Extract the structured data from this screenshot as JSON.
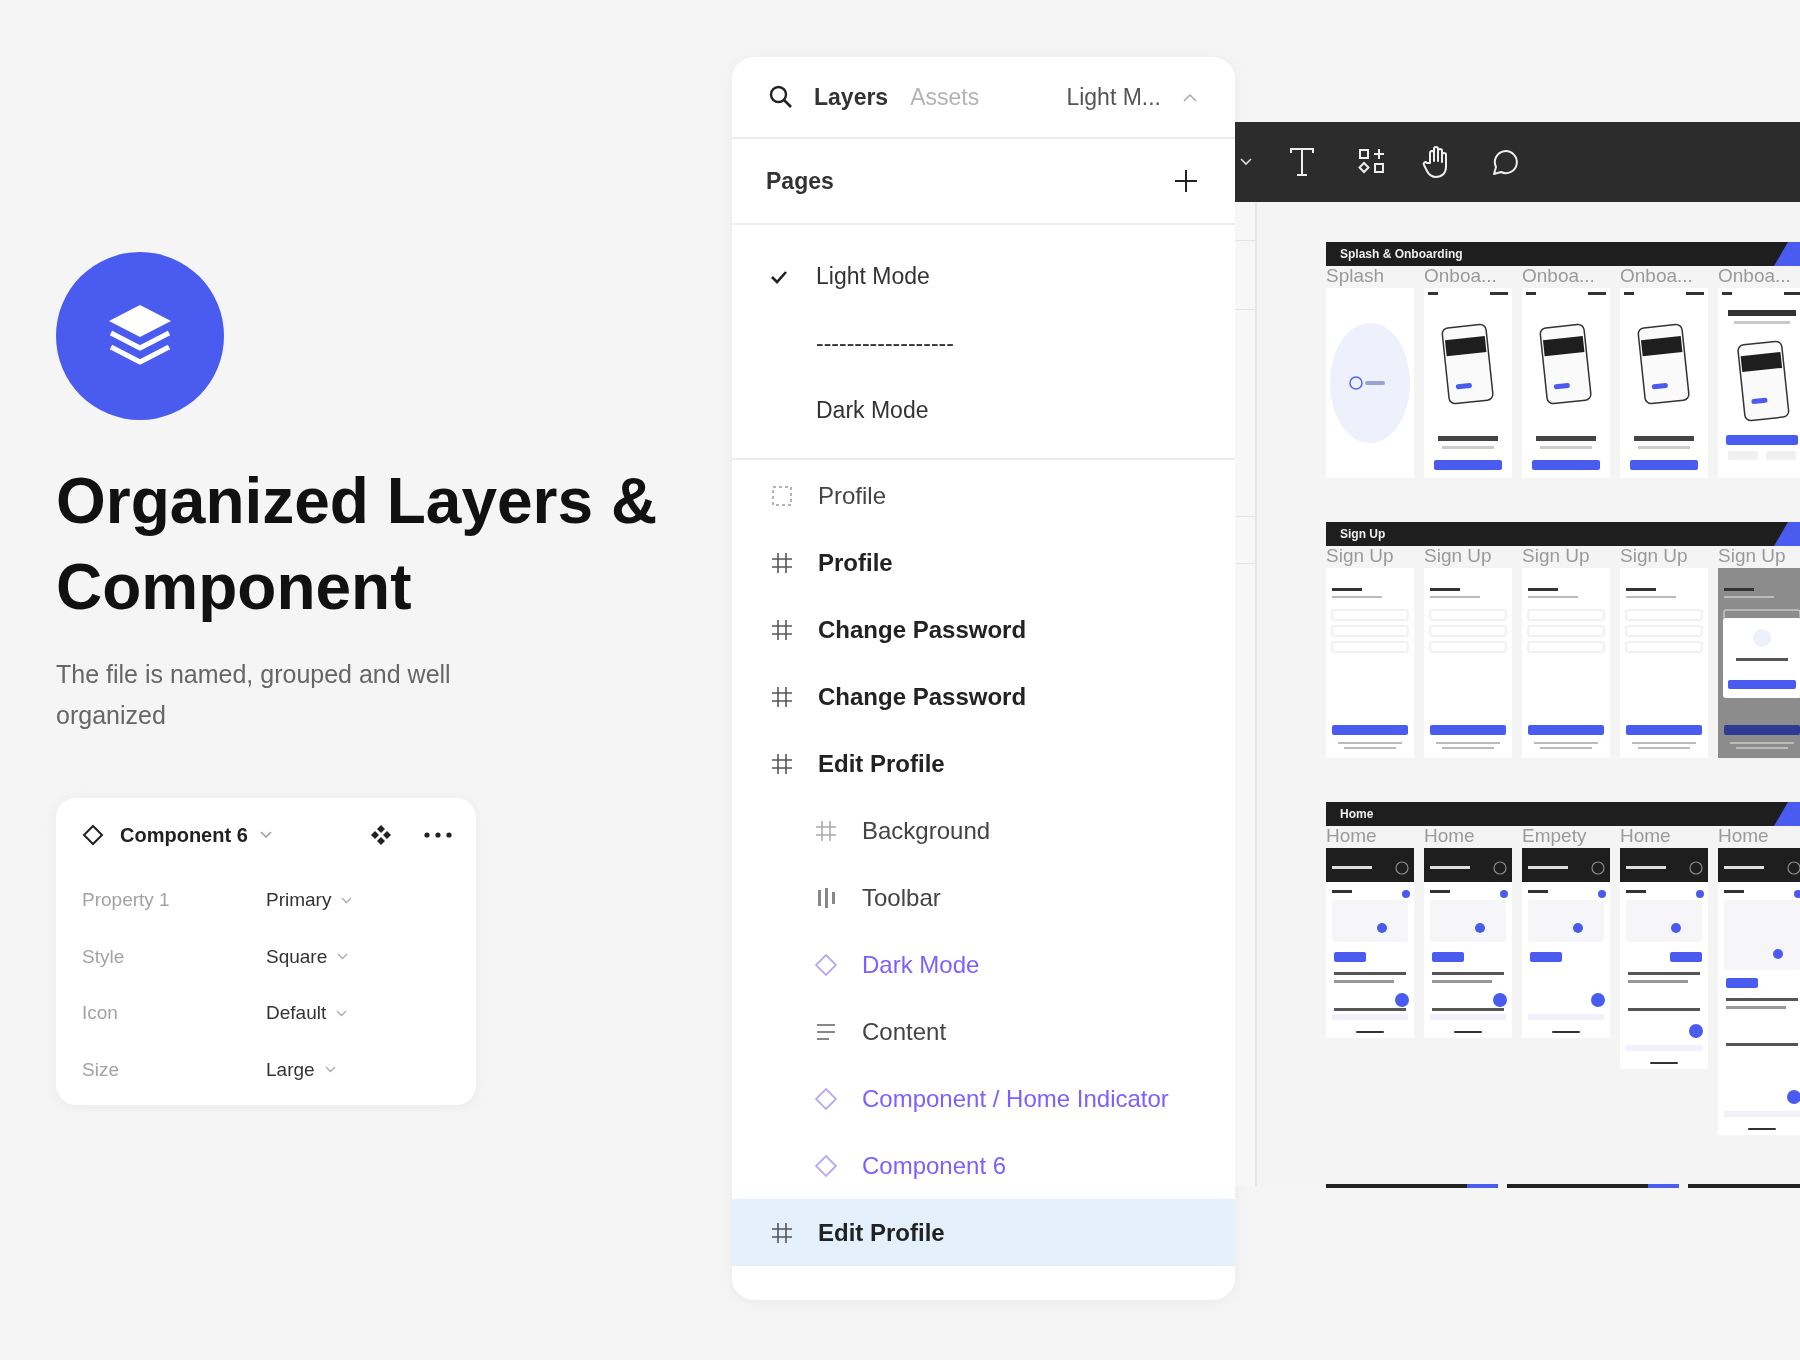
{
  "hero": {
    "title": "Organized Layers & Component",
    "subtitle": "The file is named, grouped and well organized"
  },
  "component_card": {
    "name": "Component 6",
    "properties": [
      {
        "label": "Property 1",
        "value": "Primary"
      },
      {
        "label": "Style",
        "value": "Square"
      },
      {
        "label": "Icon",
        "value": "Default"
      },
      {
        "label": "Size",
        "value": "Large"
      }
    ]
  },
  "layers_panel": {
    "tabs": [
      {
        "label": "Layers",
        "selected": true
      },
      {
        "label": "Assets",
        "selected": false
      }
    ],
    "page_menu": "Light M...",
    "pages_title": "Pages",
    "pages": [
      {
        "name": "Light Mode",
        "selected": true
      },
      {
        "name": "------------------",
        "selected": false
      },
      {
        "name": "Dark Mode",
        "selected": false
      }
    ],
    "layers": [
      {
        "name": "Profile",
        "kind": "section",
        "selected": false
      },
      {
        "name": "Profile",
        "kind": "frame",
        "selected": false
      },
      {
        "name": "Change Password",
        "kind": "frame",
        "selected": false
      },
      {
        "name": "Change Password",
        "kind": "frame",
        "selected": false
      },
      {
        "name": "Edit Profile",
        "kind": "frame",
        "selected": false,
        "children": [
          {
            "name": "Background",
            "kind": "frame",
            "selected": false
          },
          {
            "name": "Toolbar",
            "kind": "layout",
            "selected": false
          },
          {
            "name": "Dark Mode",
            "kind": "instance",
            "selected": false
          },
          {
            "name": "Content",
            "kind": "text",
            "selected": false
          },
          {
            "name": "Component / Home Indicator",
            "kind": "instance",
            "selected": false
          },
          {
            "name": "Component 6",
            "kind": "instance",
            "selected": false
          }
        ]
      },
      {
        "name": "Edit Profile",
        "kind": "frame",
        "selected": true
      }
    ]
  },
  "canvas": {
    "sections": [
      {
        "title": "Splash & Onboarding",
        "frames": [
          {
            "label": "Splash",
            "kind": "splash"
          },
          {
            "label": "Onboa...",
            "kind": "onboarding"
          },
          {
            "label": "Onboa...",
            "kind": "onboarding"
          },
          {
            "label": "Onboa...",
            "kind": "onboarding"
          },
          {
            "label": "Onboa...",
            "kind": "onboarding-start"
          }
        ]
      },
      {
        "title": "Sign Up",
        "frames": [
          {
            "label": "Sign Up",
            "kind": "signup"
          },
          {
            "label": "Sign Up",
            "kind": "signup"
          },
          {
            "label": "Sign Up",
            "kind": "signup"
          },
          {
            "label": "Sign Up",
            "kind": "signup"
          },
          {
            "label": "Sign Up",
            "kind": "signup-modal"
          }
        ]
      },
      {
        "title": "Home",
        "frames": [
          {
            "label": "Home",
            "kind": "home"
          },
          {
            "label": "Home",
            "kind": "home"
          },
          {
            "label": "Empety",
            "kind": "home-empty"
          },
          {
            "label": "Home",
            "kind": "home-list"
          },
          {
            "label": "Home",
            "kind": "home-calendar"
          }
        ]
      }
    ]
  }
}
